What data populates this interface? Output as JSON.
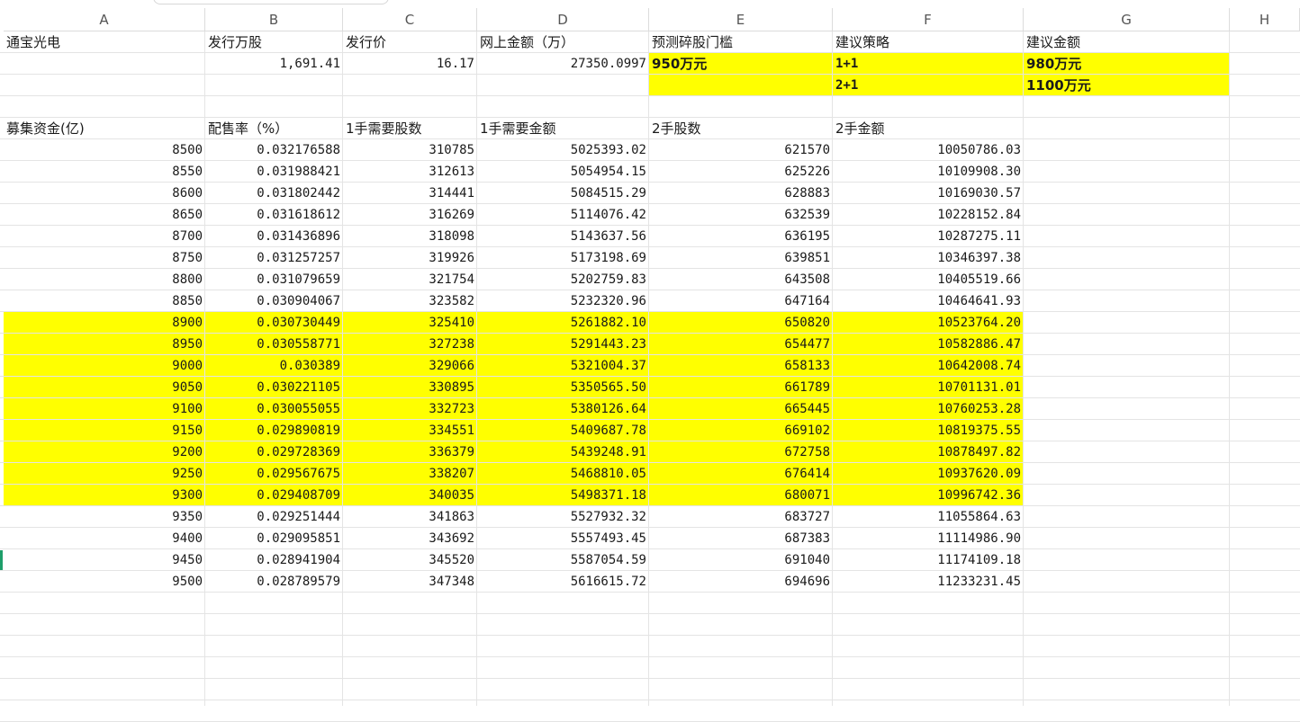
{
  "columns": [
    "A",
    "B",
    "C",
    "D",
    "E",
    "F",
    "G",
    "H"
  ],
  "info": {
    "labels": [
      "通宝光电",
      "发行万股",
      "发行价",
      "网上金额（万）",
      "预测碎股门槛",
      "建议策略",
      "建议金额"
    ],
    "shares": "1,691.41",
    "price": "16.17",
    "online_amount": "27350.0997",
    "threshold": "950万元",
    "strategy1": "1+1",
    "amount1": "980万元",
    "strategy2": "2+1",
    "amount2": "1100万元"
  },
  "table": {
    "headers": [
      "募集资金(亿)",
      "配售率（%）",
      "1手需要股数",
      "1手需要金额",
      "2手股数",
      "2手金额"
    ],
    "rows": [
      [
        "8500",
        "0.032176588",
        "310785",
        "5025393.02",
        "621570",
        "10050786.03"
      ],
      [
        "8550",
        "0.031988421",
        "312613",
        "5054954.15",
        "625226",
        "10109908.30"
      ],
      [
        "8600",
        "0.031802442",
        "314441",
        "5084515.29",
        "628883",
        "10169030.57"
      ],
      [
        "8650",
        "0.031618612",
        "316269",
        "5114076.42",
        "632539",
        "10228152.84"
      ],
      [
        "8700",
        "0.031436896",
        "318098",
        "5143637.56",
        "636195",
        "10287275.11"
      ],
      [
        "8750",
        "0.031257257",
        "319926",
        "5173198.69",
        "639851",
        "10346397.38"
      ],
      [
        "8800",
        "0.031079659",
        "321754",
        "5202759.83",
        "643508",
        "10405519.66"
      ],
      [
        "8850",
        "0.030904067",
        "323582",
        "5232320.96",
        "647164",
        "10464641.93"
      ],
      [
        "8900",
        "0.030730449",
        "325410",
        "5261882.10",
        "650820",
        "10523764.20"
      ],
      [
        "8950",
        "0.030558771",
        "327238",
        "5291443.23",
        "654477",
        "10582886.47"
      ],
      [
        "9000",
        "0.030389",
        "329066",
        "5321004.37",
        "658133",
        "10642008.74"
      ],
      [
        "9050",
        "0.030221105",
        "330895",
        "5350565.50",
        "661789",
        "10701131.01"
      ],
      [
        "9100",
        "0.030055055",
        "332723",
        "5380126.64",
        "665445",
        "10760253.28"
      ],
      [
        "9150",
        "0.029890819",
        "334551",
        "5409687.78",
        "669102",
        "10819375.55"
      ],
      [
        "9200",
        "0.029728369",
        "336379",
        "5439248.91",
        "672758",
        "10878497.82"
      ],
      [
        "9250",
        "0.029567675",
        "338207",
        "5468810.05",
        "676414",
        "10937620.09"
      ],
      [
        "9300",
        "0.029408709",
        "340035",
        "5498371.18",
        "680071",
        "10996742.36"
      ],
      [
        "9350",
        "0.029251444",
        "341863",
        "5527932.32",
        "683727",
        "11055864.63"
      ],
      [
        "9400",
        "0.029095851",
        "343692",
        "5557493.45",
        "687383",
        "11114986.90"
      ],
      [
        "9450",
        "0.028941904",
        "345520",
        "5587054.59",
        "691040",
        "11174109.18"
      ],
      [
        "9500",
        "0.028789579",
        "347348",
        "5616615.72",
        "694696",
        "11233231.45"
      ]
    ],
    "highlighted_rows": [
      "8900",
      "8950",
      "9000",
      "9050",
      "9100",
      "9150",
      "9200",
      "9250",
      "9300"
    ]
  },
  "colors": {
    "highlight": "#ffff00",
    "active_row_marker": "#1e9e6a"
  }
}
